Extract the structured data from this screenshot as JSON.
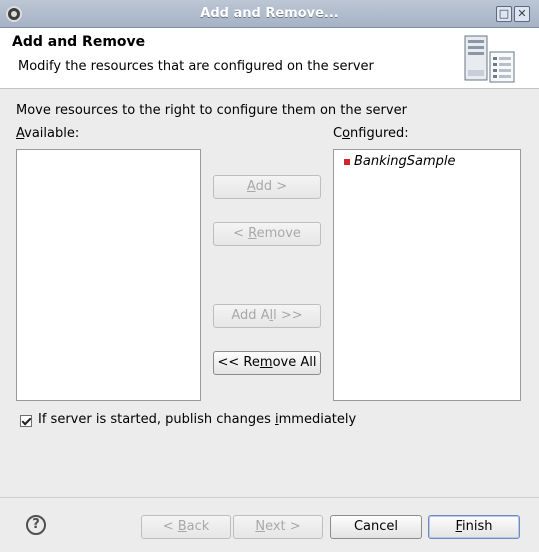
{
  "window": {
    "title": "Add and Remove...",
    "app_icon": "eclipse-icon",
    "controls": [
      "maximize-icon",
      "close-icon"
    ]
  },
  "header": {
    "title": "Add and Remove",
    "description": "Modify the resources that are configured on the server",
    "icon": "server-icon"
  },
  "main": {
    "instruction": "Move resources to the right to configure them on the server",
    "available_label": "Available:",
    "configured_label": "Configured:",
    "available_items": [],
    "configured_items": [
      {
        "label": "BankingSample",
        "status_color": "#d2272a"
      }
    ]
  },
  "buttons": {
    "add": "Add >",
    "remove": "< Remove",
    "add_all": "Add All >>",
    "remove_all": "<< Remove All"
  },
  "options": {
    "publish_label": "If server is started, publish changes immediately",
    "publish_checked": true
  },
  "footer": {
    "back": "< Back",
    "next": "Next >",
    "cancel": "Cancel",
    "finish": "Finish",
    "help_icon": "help-icon"
  }
}
